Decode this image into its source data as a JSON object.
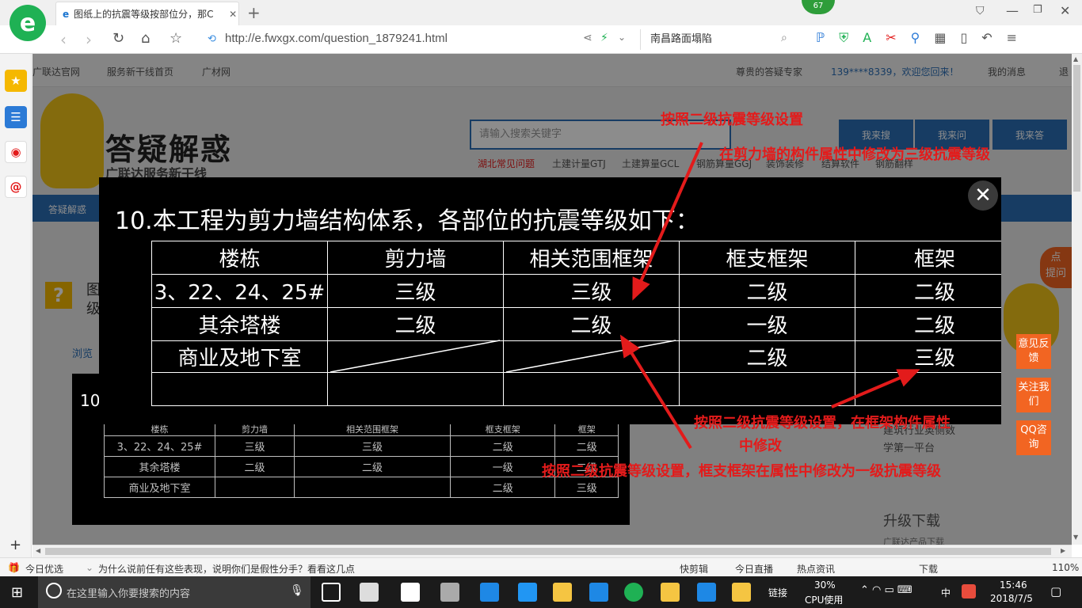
{
  "browser": {
    "tab_title": "图纸上的抗震等级按部位分，那C",
    "url": "http://e.fwxgx.com/question_1879241.html",
    "search_text": "南昌路面塌陷",
    "badge_count": "67"
  },
  "site": {
    "topnav": [
      "广联达官网",
      "服务新干线首页",
      "广材网"
    ],
    "topnav_right": [
      "尊贵的答疑专家",
      "139****8339，欢迎您回来！",
      "我的消息",
      "退"
    ],
    "logo_title": "答疑解惑",
    "logo_sub": "广联达服务新干线",
    "search_placeholder": "请输入搜索关键字",
    "search_buttons": [
      "我来搜",
      "我来问",
      "我来答"
    ],
    "tags": [
      "湖北常见问题",
      "土建计量GTJ",
      "土建算量GCL",
      "钢筋算量GGJ",
      "装饰装修",
      "结算软件",
      "钢筋翻样"
    ],
    "breadcrumb": "答疑解惑",
    "question_prefix": "图",
    "question_prefix2": "级",
    "browse": "浏览",
    "right_tags": [
      "点",
      "提问"
    ],
    "float_buttons": [
      "意见反馈",
      "关注我们",
      "QQ咨询"
    ],
    "platform_text": [
      "建筑行业奥侧数",
      "学第一平台"
    ],
    "upgrade": "升级下载",
    "upgrade_sub": "广联达产品下载"
  },
  "image": {
    "title": "10.本工程为剪力墙结构体系，各部位的抗震等级如下：",
    "headers": [
      "楼栋",
      "剪力墙",
      "相关范围框架",
      "框支框架",
      "框架"
    ],
    "rows": [
      [
        "3、22、24、25#",
        "三级",
        "三级",
        "二级",
        "二级"
      ],
      [
        "其余塔楼",
        "二级",
        "二级",
        "一级",
        "二级"
      ],
      [
        "商业及地下室",
        "",
        "",
        "二级",
        "三级"
      ]
    ],
    "small_title": "10."
  },
  "annotations": {
    "a1": "按照二级抗震等级设置",
    "a2": "在剪力墙的构件属性中修改为三级抗震等级",
    "a3_line1": "按照二级抗震等级设置，在框架构件属性",
    "a3_line2": "中修改",
    "a4": "按照二级抗震等级设置，框支框架在属性中修改为一级抗震等级"
  },
  "statusbar": {
    "left": "今日优选",
    "news": "为什么说前任有这些表现，说明你们是假性分手？看看这几点",
    "items": [
      "快剪辑",
      "今日直播",
      "热点资讯",
      "下载"
    ],
    "zoom": "110%"
  },
  "taskbar": {
    "search_placeholder": "在这里输入你要搜索的内容",
    "link_label": "链接",
    "cpu": "30%",
    "cpu_label": "CPU使用",
    "lang": "中",
    "time": "15:46",
    "date": "2018/7/5"
  },
  "colors": {
    "accent": "#2a6db5",
    "annotation": "#e31b1b",
    "float_btn": "#f26522"
  }
}
